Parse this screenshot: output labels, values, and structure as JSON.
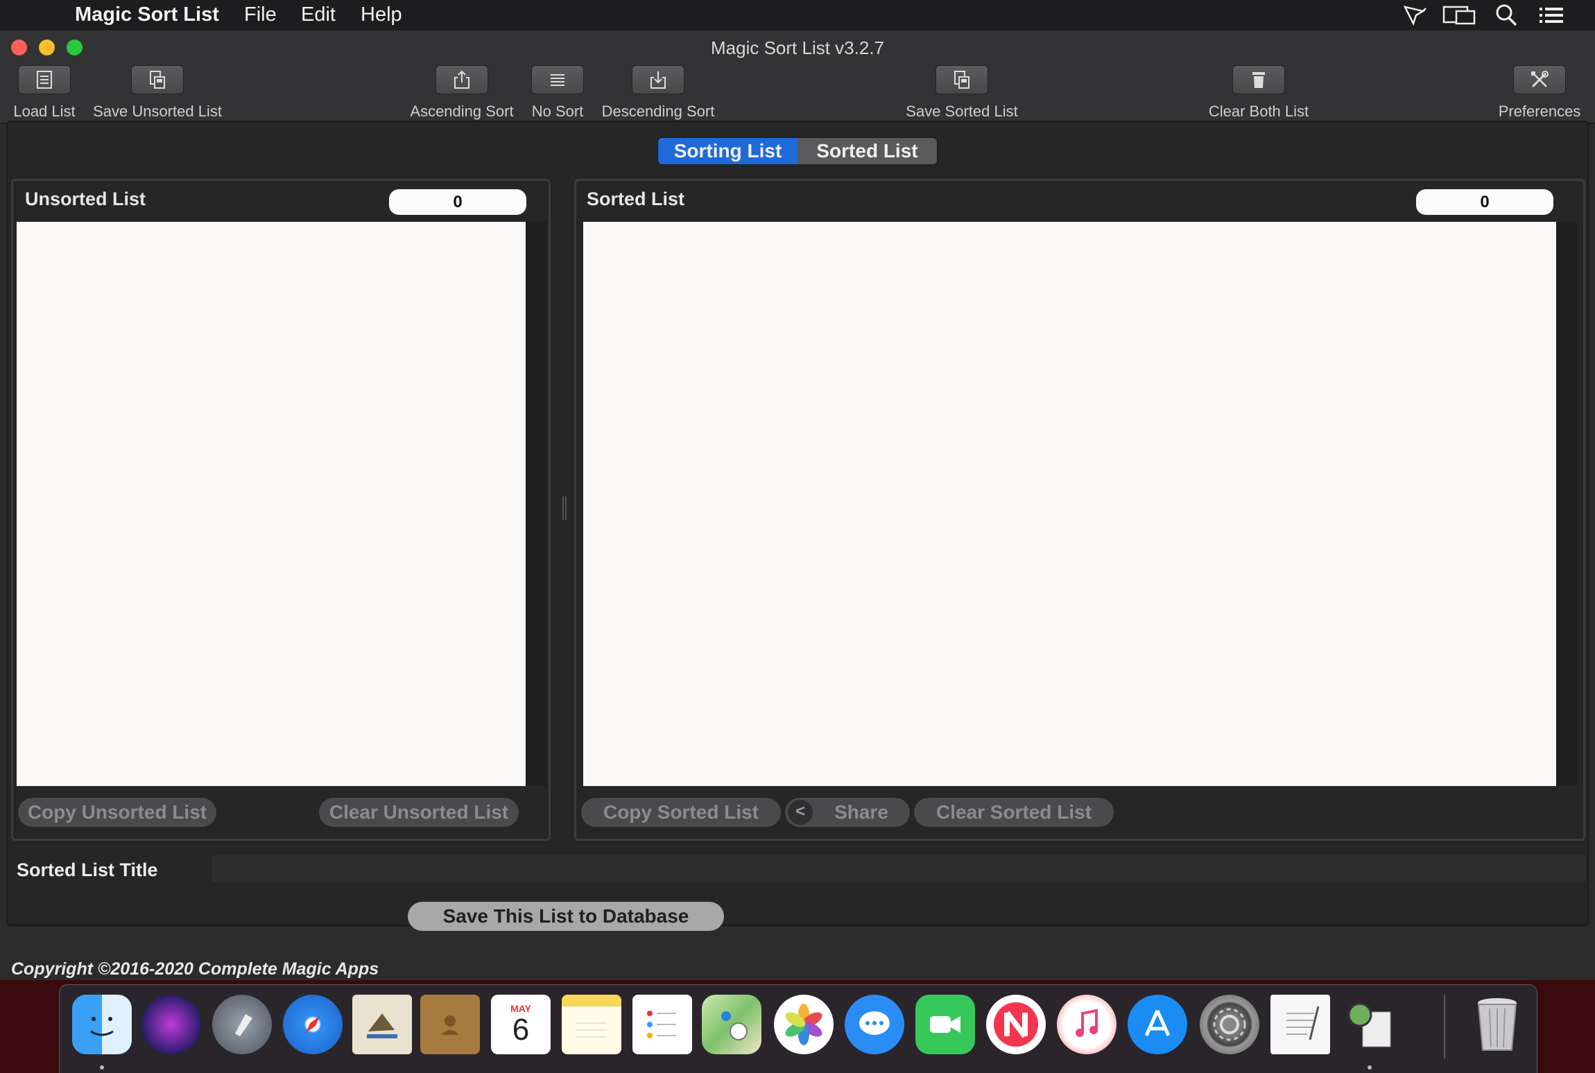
{
  "menubar": {
    "apple_glyph": "",
    "app_name": "Magic Sort List",
    "menus": [
      "File",
      "Edit",
      "Help"
    ],
    "status_icons": [
      "airplay-icon",
      "display-icon",
      "search-icon",
      "list-icon"
    ]
  },
  "window": {
    "title": "Magic Sort List v3.2.7",
    "toolbar": {
      "load_list": "Load List",
      "save_unsorted_list": "Save Unsorted List",
      "ascending_sort": "Ascending Sort",
      "no_sort": "No Sort",
      "descending_sort": "Descending Sort",
      "save_sorted_list": "Save Sorted List",
      "clear_both_list": "Clear Both List",
      "preferences": "Preferences"
    },
    "tabs": [
      "Sorting List",
      "Sorted List"
    ],
    "selected_tab": "Sorting List",
    "unsorted_panel": {
      "title": "Unsorted List",
      "count": "0",
      "copy_button": "Copy Unsorted List",
      "clear_button": "Clear Unsorted List"
    },
    "sorted_panel": {
      "title": "Sorted List",
      "count": "0",
      "copy_button": "Copy Sorted List",
      "share_button": "Share",
      "share_glyph": "<",
      "clear_button": "Clear Sorted List"
    },
    "title_field": {
      "label": "Sorted List Title",
      "value": ""
    },
    "save_database_button": "Save This List to Database",
    "copyright": "Copyright ©2016-2020 Complete Magic Apps"
  },
  "dock": {
    "calendar_month": "MAY",
    "calendar_day": "6",
    "apps": [
      "finder-icon",
      "siri-icon",
      "launchpad-icon",
      "safari-icon",
      "mail-icon",
      "contacts-icon",
      "calendar-icon",
      "notes-icon",
      "reminders-icon",
      "maps-icon",
      "photos-icon",
      "messages-icon",
      "facetime-icon",
      "news-icon",
      "music-icon",
      "app-store-icon",
      "system-preferences-icon",
      "textedit-icon",
      "preview-icon",
      "trash-icon"
    ]
  },
  "colors": {
    "accent": "#1f6ad9",
    "window_bg": "#2b2b2b",
    "list_bg": "#fbfaf9"
  }
}
